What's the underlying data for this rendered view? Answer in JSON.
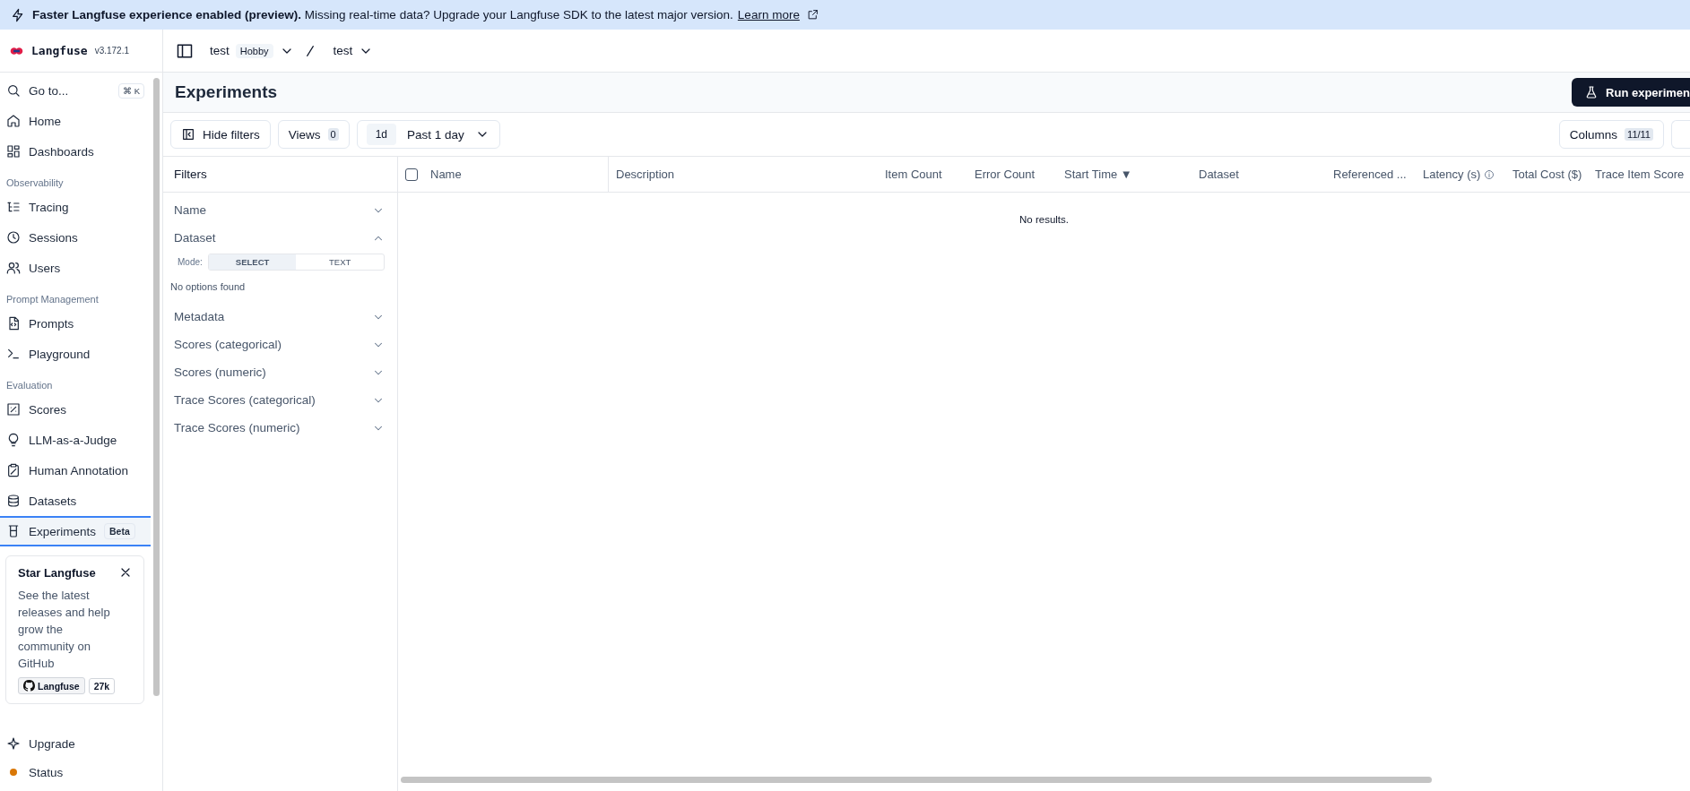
{
  "banner": {
    "bold": "Faster Langfuse experience enabled (preview).",
    "text": "Missing real-time data? Upgrade your Langfuse SDK to the latest major version.",
    "link": "Learn more"
  },
  "sidebar": {
    "brand": "Langfuse",
    "version": "v3.172.1",
    "search": {
      "label": "Go to...",
      "shortcut": "⌘ K"
    },
    "groups": [
      {
        "items": [
          {
            "label": "Home",
            "selected": false
          },
          {
            "label": "Dashboards",
            "selected": false
          }
        ]
      },
      {
        "title": "Observability",
        "items": [
          {
            "label": "Tracing",
            "selected": false
          },
          {
            "label": "Sessions",
            "selected": false
          },
          {
            "label": "Users",
            "selected": false
          }
        ]
      },
      {
        "title": "Prompt Management",
        "items": [
          {
            "label": "Prompts",
            "selected": false
          },
          {
            "label": "Playground",
            "selected": false
          }
        ]
      },
      {
        "title": "Evaluation",
        "items": [
          {
            "label": "Scores",
            "selected": false
          },
          {
            "label": "LLM-as-a-Judge",
            "selected": false
          },
          {
            "label": "Human Annotation",
            "selected": false
          },
          {
            "label": "Datasets",
            "selected": false
          },
          {
            "label": "Experiments",
            "selected": true,
            "badge": "Beta"
          }
        ]
      }
    ],
    "promo": {
      "title": "Star Langfuse",
      "body": "See the latest releases and help grow the community on GitHub",
      "repo": "Langfuse",
      "stars": "27k"
    },
    "footer": [
      {
        "label": "Upgrade",
        "kind": "link"
      },
      {
        "label": "Status",
        "kind": "status"
      }
    ]
  },
  "breadcrumb": [
    {
      "label": "test",
      "badge": "Hobby"
    },
    {
      "label": "test"
    }
  ],
  "page": {
    "title": "Experiments",
    "action": "Run experimen"
  },
  "toolbar": {
    "hide_filters": "Hide filters",
    "views": {
      "label": "Views",
      "count": "0"
    },
    "range": {
      "short": "1d",
      "label": "Past 1 day"
    },
    "columns": {
      "label": "Columns",
      "count": "11/11"
    }
  },
  "filters": {
    "title": "Filters",
    "items": [
      {
        "label": "Name",
        "expanded": false
      },
      {
        "label": "Dataset",
        "expanded": true,
        "mode": {
          "label": "Mode:",
          "options": [
            {
              "label": "SELECT",
              "selected": true
            },
            {
              "label": "TEXT",
              "selected": false
            }
          ]
        },
        "empty": "No options found"
      },
      {
        "label": "Metadata",
        "expanded": false
      },
      {
        "label": "Scores (categorical)",
        "expanded": false
      },
      {
        "label": "Scores (numeric)",
        "expanded": false
      },
      {
        "label": "Trace Scores (categorical)",
        "expanded": false
      },
      {
        "label": "Trace Scores (numeric)",
        "expanded": false
      }
    ]
  },
  "table": {
    "select_all": false,
    "columns": [
      {
        "label": "Name"
      },
      {
        "label": "Description"
      },
      {
        "label": "Item Count"
      },
      {
        "label": "Error Count"
      },
      {
        "label": "Start Time ▼"
      },
      {
        "label": "Dataset"
      },
      {
        "label": "Referenced ..."
      },
      {
        "label": "Latency (s)",
        "info": true
      },
      {
        "label": "Total Cost ($)"
      },
      {
        "label": "Trace Item Score"
      }
    ],
    "empty": "No results."
  }
}
